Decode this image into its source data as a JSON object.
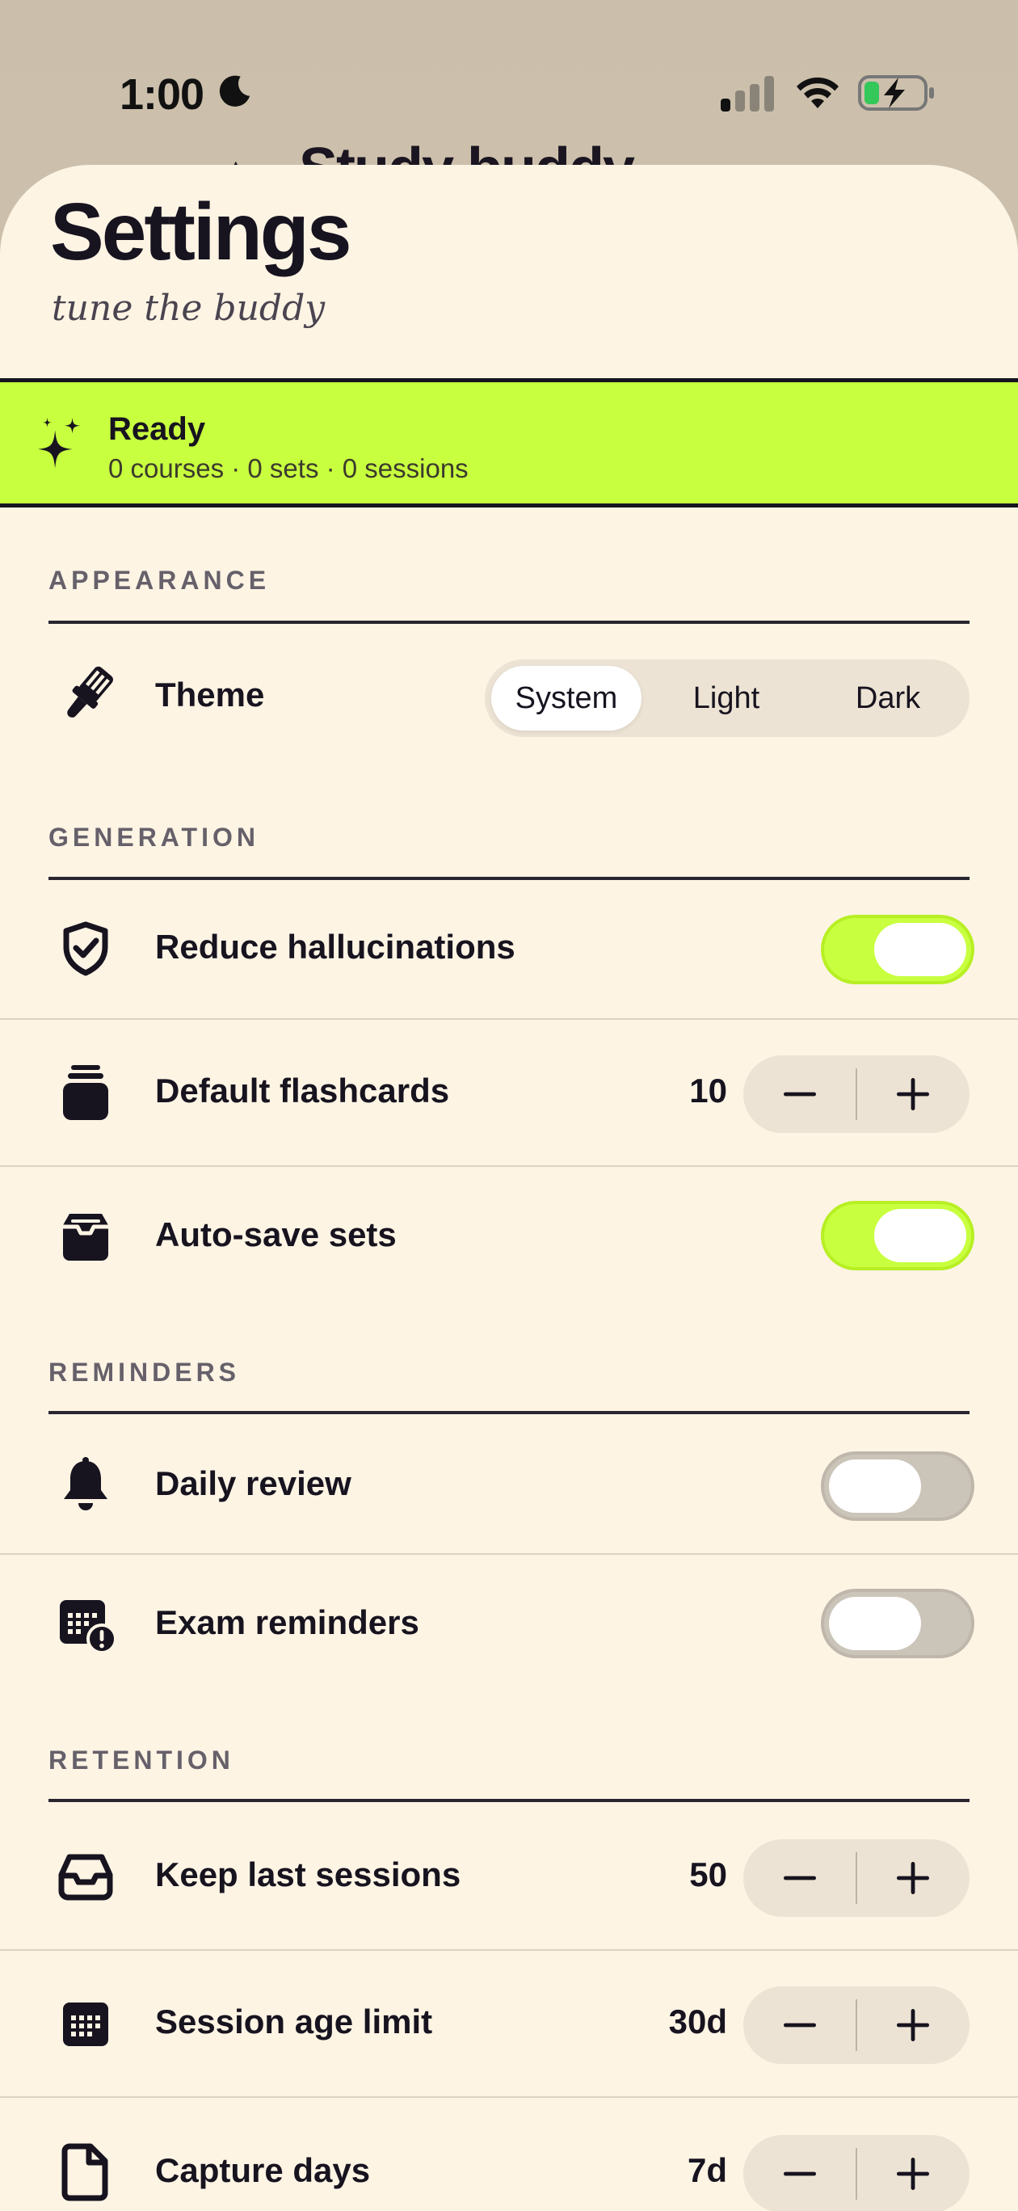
{
  "status_bar": {
    "time": "1:00",
    "icons": [
      "moon-icon",
      "cellular-signal-icon",
      "wifi-icon",
      "battery-charging-icon"
    ]
  },
  "background_screen": {
    "title": "Study buddy"
  },
  "header": {
    "title": "Settings",
    "subtitle": "tune the buddy"
  },
  "status_banner": {
    "icon": "sparkles-icon",
    "title": "Ready",
    "detail": "0 courses · 0 sets · 0 sessions",
    "color": "#c8ff3f"
  },
  "sections": {
    "appearance": {
      "label": "APPEARANCE",
      "theme": {
        "icon": "paintbrush-icon",
        "label": "Theme",
        "options": [
          "System",
          "Light",
          "Dark"
        ],
        "selected": "System"
      }
    },
    "generation": {
      "label": "GENERATION",
      "reduce_hallucinations": {
        "icon": "shield-check-icon",
        "label": "Reduce hallucinations",
        "enabled": true
      },
      "default_flashcards": {
        "icon": "card-stack-icon",
        "label": "Default flashcards",
        "value": "10"
      },
      "auto_save_sets": {
        "icon": "archive-tray-icon",
        "label": "Auto-save sets",
        "enabled": true
      }
    },
    "reminders": {
      "label": "REMINDERS",
      "daily_review": {
        "icon": "bell-icon",
        "label": "Daily review",
        "enabled": false
      },
      "exam_reminders": {
        "icon": "calendar-alert-icon",
        "label": "Exam reminders",
        "enabled": false
      }
    },
    "retention": {
      "label": "RETENTION",
      "keep_last_sessions": {
        "icon": "inbox-icon",
        "label": "Keep last sessions",
        "value": "50"
      },
      "session_age_limit": {
        "icon": "calendar-icon",
        "label": "Session age limit",
        "value": "30d"
      },
      "capture_days": {
        "icon": "document-icon",
        "label": "Capture days",
        "value": "7d"
      }
    }
  },
  "colors": {
    "accent": "#c8ff3f",
    "sheet_background": "#fdf4e4",
    "text": "#17131f",
    "control_background": "#ece3d4"
  }
}
